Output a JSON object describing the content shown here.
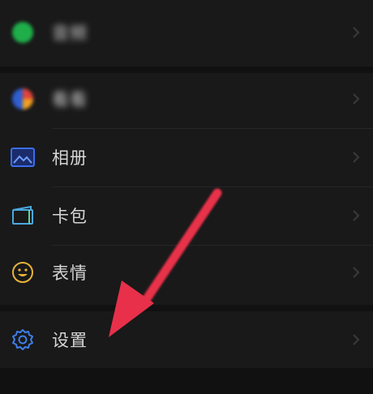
{
  "menu": {
    "items": [
      {
        "label": "音频",
        "icon": "green-circle-icon",
        "blurred": true
      },
      {
        "label": "看看",
        "icon": "mini-program-icon",
        "blurred": true
      },
      {
        "label": "相册",
        "icon": "photo-album-icon",
        "blurred": false
      },
      {
        "label": "卡包",
        "icon": "card-wallet-icon",
        "blurred": false
      },
      {
        "label": "表情",
        "icon": "smiley-icon",
        "blurred": false
      },
      {
        "label": "设置",
        "icon": "gear-icon",
        "blurred": false
      }
    ]
  },
  "colors": {
    "background": "#111111",
    "row_background": "#191919",
    "text": "#d6d6d6",
    "chevron": "#3a3a3a",
    "arrow": "#e8304a",
    "album_icon": "#3a6df0",
    "card_icon": "#4aa8e0",
    "smiley_icon": "#e9b23a",
    "gear_icon": "#3f7ee8"
  }
}
